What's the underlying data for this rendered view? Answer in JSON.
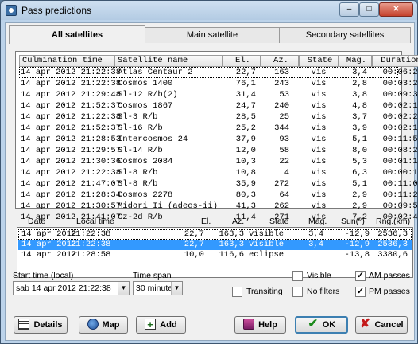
{
  "window": {
    "title": "Pass predictions"
  },
  "tabs": [
    "All satellites",
    "Main satellite",
    "Secondary satellites"
  ],
  "passes": {
    "headers": [
      "Culmination time",
      "Satellite name",
      "El.",
      "Az.",
      "State",
      "Mag.",
      "Duration"
    ],
    "rows": [
      [
        "14 apr 2012 21:22:38",
        "Atlas Centaur 2",
        "22,7",
        "163",
        "vis",
        "3,4",
        "00:06:20"
      ],
      [
        "14 apr 2012 21:22:38",
        "Cosmos 1400",
        "76,1",
        "243",
        "vis",
        "2,8",
        "00:03:22"
      ],
      [
        "14 apr 2012 21:29:48",
        "Sl-12 R/b(2)",
        "31,4",
        "53",
        "vis",
        "3,8",
        "00:09:38"
      ],
      [
        "14 apr 2012 21:52:37",
        "Cosmos 1867",
        "24,7",
        "240",
        "vis",
        "4,8",
        "00:02:14"
      ],
      [
        "14 apr 2012 21:22:38",
        "Sl-3 R/b",
        "28,5",
        "25",
        "vis",
        "3,7",
        "00:02:25"
      ],
      [
        "14 apr 2012 21:52:37",
        "Sl-16 R/b",
        "25,2",
        "344",
        "vis",
        "3,9",
        "00:02:18"
      ],
      [
        "14 apr 2012 21:28:53",
        "Intercosmos 24",
        "37,9",
        "93",
        "vis",
        "5,1",
        "00:11:54"
      ],
      [
        "14 apr 2012 21:29:57",
        "Sl-14 R/b",
        "12,0",
        "58",
        "vis",
        "8,0",
        "00:08:21"
      ],
      [
        "14 apr 2012 21:30:36",
        "Cosmos 2084",
        "10,3",
        "22",
        "vis",
        "5,3",
        "00:01:14"
      ],
      [
        "14 apr 2012 21:22:38",
        "Sl-8 R/b",
        "10,8",
        "4",
        "vis",
        "6,3",
        "00:00:11"
      ],
      [
        "14 apr 2012 21:47:07",
        "Sl-8 R/b",
        "35,9",
        "272",
        "vis",
        "5,1",
        "00:11:05"
      ],
      [
        "14 apr 2012 21:28:34",
        "Cosmos 2278",
        "80,3",
        "64",
        "vis",
        "2,9",
        "00:11:24"
      ],
      [
        "14 apr 2012 21:30:57",
        "Midori Ii (adeos-ii)",
        "41,3",
        "262",
        "vis",
        "2,9",
        "00:09:57"
      ],
      [
        "14 apr 2012 21:41:07",
        "Cz-2d R/b",
        "11,4",
        "271",
        "vis",
        "7,2",
        "00:02:42"
      ]
    ]
  },
  "details": {
    "headers": [
      "Date",
      "Local time",
      "El.",
      "Az.",
      "State",
      "Mag.",
      "Sun(°)",
      "Rng.(km)"
    ],
    "rows": [
      [
        "14 apr 2012",
        "21:22:38",
        "22,7",
        "163,3",
        "visible",
        "3,4",
        "-12,9",
        "2536,3"
      ],
      [
        "14 apr 2012",
        "21:22:38",
        "22,7",
        "163,3",
        "visible",
        "3,4",
        "-12,9",
        "2536,3"
      ],
      [
        "14 apr 2012",
        "21:28:58",
        "10,0",
        "116,6",
        "eclipse",
        "",
        "-13,8",
        "3380,6"
      ]
    ]
  },
  "controls": {
    "start_time_label": "Start time (local)",
    "start_time_value": "sab 14 apr 2012   21:22:38",
    "time_span_label": "Time span",
    "time_span_value": "30 minutes",
    "transiting_label": "Transiting",
    "transiting_checked": "",
    "visible_label": "Visible",
    "visible_checked": "",
    "no_filters_label": "No filters",
    "no_filters_checked": "",
    "am_label": "AM passes",
    "am_checked": "✓",
    "pm_label": "PM passes",
    "pm_checked": "✓"
  },
  "buttons": {
    "details": "Details",
    "map": "Map",
    "add": "Add",
    "help": "Help",
    "ok": "OK",
    "cancel": "Cancel"
  },
  "icons": [
    "app-icon",
    "minimize-icon",
    "maximize-icon",
    "close-icon",
    "details-icon",
    "map-icon",
    "add-icon",
    "help-icon",
    "ok-icon",
    "cancel-icon"
  ],
  "colors": {
    "selection": "#3399ff",
    "window_frame": "#bcd3ea"
  }
}
